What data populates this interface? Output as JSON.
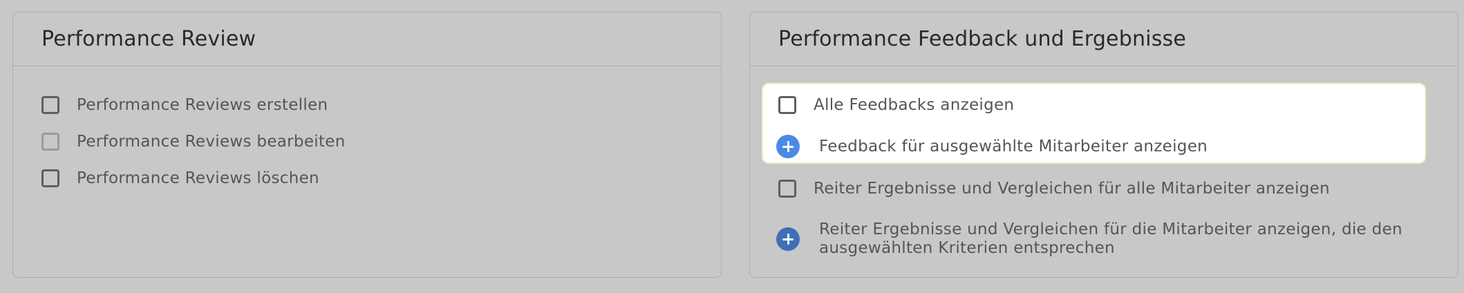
{
  "left_panel": {
    "title": "Performance Review",
    "items": [
      {
        "label": "Performance Reviews erstellen",
        "checked": false,
        "disabled": false
      },
      {
        "label": "Performance Reviews bearbeiten",
        "checked": false,
        "disabled": true
      },
      {
        "label": "Performance Reviews löschen",
        "checked": false,
        "disabled": false
      }
    ]
  },
  "right_panel": {
    "title": "Performance Feedback und Ergebnisse",
    "items": [
      {
        "type": "checkbox",
        "label": "Alle Feedbacks anzeigen",
        "checked": false
      },
      {
        "type": "add",
        "label": "Feedback für ausgewählte Mitarbeiter anzeigen"
      },
      {
        "type": "checkbox",
        "label": "Reiter Ergebnisse und Vergleichen für alle Mitarbeiter anzeigen",
        "checked": false
      },
      {
        "type": "add",
        "label_line1": "Reiter Ergebnisse und Vergleichen für die Mitarbeiter anzeigen, die den",
        "label_line2": "ausgewählten Kriterien entsprechen"
      }
    ]
  },
  "colors": {
    "page_background": "#c8c8c8",
    "highlight_background": "#ffffff",
    "add_button": "#3f6fb6",
    "add_button_highlighted": "#4a8ae6"
  },
  "icons": {
    "add": "plus-circle-icon",
    "checkbox": "checkbox-icon"
  }
}
